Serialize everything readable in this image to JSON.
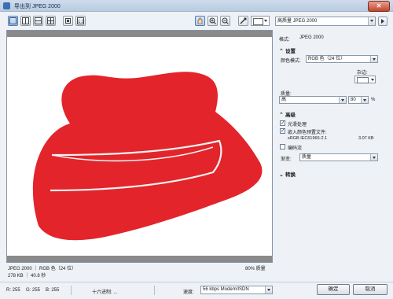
{
  "window": {
    "title": "导出到 JPEG 2000",
    "close_glyph": "✕"
  },
  "toolbar": {
    "view_buttons": [
      "single-view",
      "split-vertical",
      "split-horizontal",
      "quad-view",
      "fit-icon",
      "one-to-one-icon"
    ],
    "tools": [
      "pan-hand-icon",
      "zoom-in-icon",
      "zoom-out-icon",
      "eyedropper-icon"
    ],
    "preset": "高质量 JPEG 2000"
  },
  "preview": {
    "format_line": "JPEG 2000 ｜ RGB 色（24 位）",
    "size_line": "278 KB ｜ 40.8 秒",
    "quality_line": "80% 质量"
  },
  "panel": {
    "format_label": "格式:",
    "format_value": "JPEG 2000",
    "settings_header": "设置",
    "color_mode_label": "颜色模式:",
    "color_mode_value": "RGB 色（24 位）",
    "matte_label": "杂边:",
    "quality_label": "质量:",
    "quality_value": "高",
    "quality_number": "80",
    "quality_unit": "%",
    "advanced_header": "高级",
    "smooth_label": "光滑处理",
    "smooth_checked": true,
    "embed_label": "嵌入颜色预置文件:",
    "embed_checked": true,
    "profile_name": "sRGB IEC61966-2.1",
    "profile_size": "3.07 KB",
    "encode_label": "编码流",
    "encode_checked": false,
    "gradient_label": "渐变:",
    "gradient_value": "质量",
    "transform_header": "转换"
  },
  "status": {
    "r": "R: 255",
    "g": "G: 255",
    "b": "B: 255",
    "hex_label": "十六进制: ...",
    "speed_label": "速度:",
    "speed_value": "56 kbps Modem/ISDN",
    "ok": "确定",
    "cancel": "取消"
  },
  "colors": {
    "hat": "#e3242b",
    "band": "#f2f2f2",
    "accent": "#4e79b5"
  }
}
